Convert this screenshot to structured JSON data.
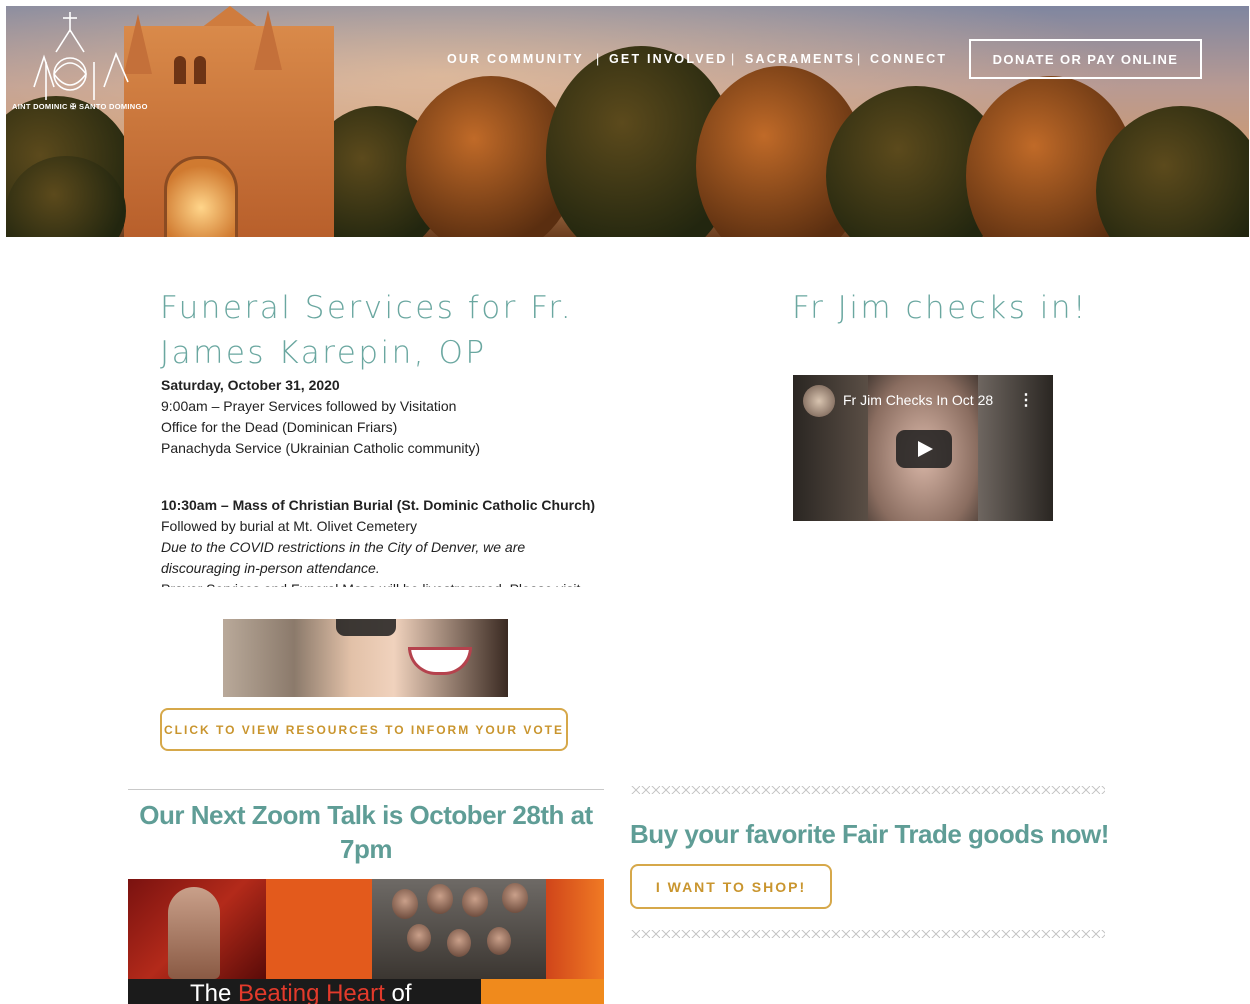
{
  "logo": {
    "text": "AINT DOMINIC ✠ SANTO DOMINGO"
  },
  "nav": {
    "items": [
      "OUR COMMUNITY",
      "GET INVOLVED",
      "SACRAMENTS",
      "CONNECT"
    ],
    "separator": "|",
    "donate_label": "DONATE OR PAY ONLINE"
  },
  "funeral": {
    "title": "Funeral Services for Fr. James Karepin, OP",
    "date": "Saturday, October 31, 2020",
    "line1": "9:00am – Prayer Services followed by Visitation",
    "line2": "Office for the Dead (Dominican Friars)",
    "line3": "Panachyda Service (Ukrainian Catholic community)",
    "mass": "10:30am – Mass of Christian Burial (St. Dominic Catholic Church)",
    "burial": "Followed by burial at Mt. Olivet Cemetery",
    "covid": "Due to the COVID restrictions in the City of Denver, we are discouraging in-person attendance.",
    "cutoff": "Prayer Services and Funeral Mass will be livestreamed. Please visit the St."
  },
  "video": {
    "section_title": "Fr Jim checks in!",
    "title": "Fr Jim Checks In Oct 28",
    "menu": "⋮"
  },
  "vote": {
    "button_label": "CLICK TO VIEW RESOURCES TO INFORM YOUR VOTE"
  },
  "zoom": {
    "title": "Our Next Zoom Talk is October 28th at 7pm",
    "caption_pre": "The ",
    "caption_red": "Beating Heart",
    "caption_post": " of"
  },
  "fairtrade": {
    "title": "Buy your favorite Fair Trade goods now!",
    "button_label": "I WANT TO SHOP!"
  },
  "colors": {
    "teal": "#6aa7a0",
    "gold": "#d6a84a"
  }
}
